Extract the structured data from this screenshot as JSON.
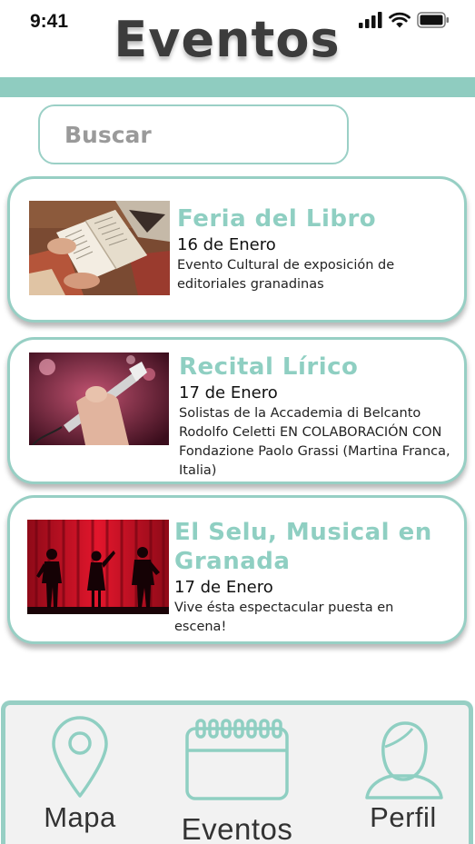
{
  "status": {
    "time": "9:41"
  },
  "header": {
    "title": "Eventos"
  },
  "search": {
    "placeholder": "Buscar"
  },
  "events": [
    {
      "title": "Feria del Libro",
      "date": "16 de Enero",
      "description": "Evento Cultural de exposición de editoriales granadinas"
    },
    {
      "title": "Recital Lírico",
      "date": "17 de Enero",
      "description": "Solistas de la Accademia di Belcanto Rodolfo Celetti EN COLABORACIÓN CON Fondazione Paolo Grassi (Martina Franca, Italia)"
    },
    {
      "title": "El Selu, Musical en Granada",
      "date": "17 de Enero",
      "description": "Vive ésta espectacular puesta en escena!"
    }
  ],
  "nav": {
    "map": "Mapa",
    "events": "Eventos",
    "profile": "Perfil"
  },
  "colors": {
    "accent": "#8fcfc2",
    "band": "#8fccc0",
    "title": "#3c3c3c"
  }
}
